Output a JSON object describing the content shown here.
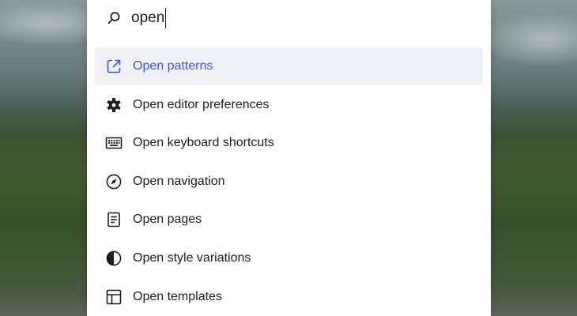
{
  "search": {
    "value": "open",
    "icon": "search-icon"
  },
  "colors": {
    "accent": "#3858e9",
    "selected_bg": "#f0f1f7",
    "text": "#1e1e1e"
  },
  "results": [
    {
      "label": "Open patterns",
      "icon": "external-link-icon",
      "selected": true
    },
    {
      "label": "Open editor preferences",
      "icon": "gear-icon",
      "selected": false
    },
    {
      "label": "Open keyboard shortcuts",
      "icon": "keyboard-icon",
      "selected": false
    },
    {
      "label": "Open navigation",
      "icon": "compass-icon",
      "selected": false
    },
    {
      "label": "Open pages",
      "icon": "page-icon",
      "selected": false
    },
    {
      "label": "Open style variations",
      "icon": "contrast-icon",
      "selected": false
    },
    {
      "label": "Open templates",
      "icon": "layout-icon",
      "selected": false
    }
  ]
}
